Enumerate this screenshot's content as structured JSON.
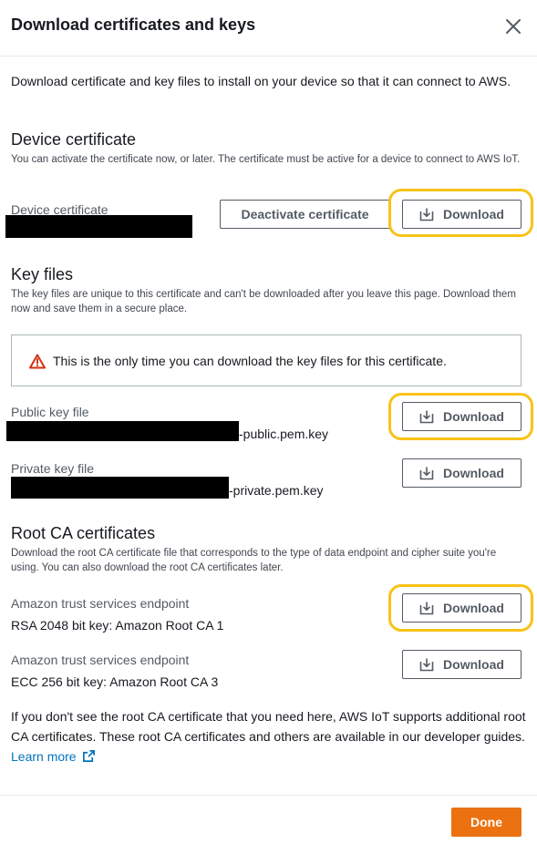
{
  "modal": {
    "title": "Download certificates and keys",
    "intro": "Download certificate and key files to install on your device so that it can connect to AWS."
  },
  "device_certificate": {
    "title": "Device certificate",
    "description": "You can activate the certificate now, or later. The certificate must be active for a device to connect to AWS IoT.",
    "field_label": "Device certificate",
    "deactivate_label": "Deactivate certificate",
    "download_label": "Download"
  },
  "key_files": {
    "title": "Key files",
    "description": "The key files are unique to this certificate and can't be downloaded after you leave this page. Download them now and save them in a secure place.",
    "alert": "This is the only time you can download the key files for this certificate.",
    "public": {
      "label": "Public key file",
      "suffix": "-public.pem.key",
      "download_label": "Download"
    },
    "private": {
      "label": "Private key file",
      "suffix": "-private.pem.key",
      "download_label": "Download"
    }
  },
  "root_ca": {
    "title": "Root CA certificates",
    "description": "Download the root CA certificate file that corresponds to the type of data endpoint and cipher suite you're using. You can also download the root CA certificates later.",
    "items": [
      {
        "label": "Amazon trust services endpoint",
        "value": "RSA 2048 bit key: Amazon Root CA 1",
        "download_label": "Download"
      },
      {
        "label": "Amazon trust services endpoint",
        "value": "ECC 256 bit key: Amazon Root CA 3",
        "download_label": "Download"
      }
    ],
    "note": "If you don't see the root CA certificate that you need here, AWS IoT supports additional root CA certificates. These root CA certificates and others are available in our developer guides.",
    "learn_more": "Learn more"
  },
  "footer": {
    "done_label": "Done"
  },
  "colors": {
    "highlight": "#f8c317",
    "primary": "#ec7211",
    "link": "#0073bb",
    "warning": "#d13212"
  },
  "icons": {
    "close": "close-icon",
    "download": "download-icon",
    "warning": "warning-icon",
    "external": "external-link-icon"
  }
}
